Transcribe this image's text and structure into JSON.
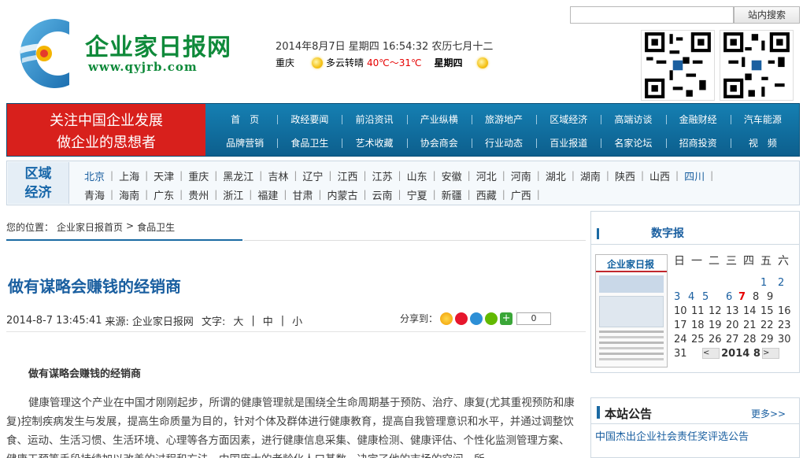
{
  "header": {
    "search_button": "站内搜索",
    "logo_cn": "企业家日报网",
    "logo_url": "www.qyjrb.com",
    "datetime": "2014年8月7日  星期四  16:54:32 农历七月十二",
    "weather": {
      "city": "重庆",
      "condition": "多云转晴",
      "temp": "40℃～31℃",
      "weekday": "星期四"
    }
  },
  "nav": {
    "slogan_line1": "关注中国企业发展",
    "slogan_line2": "做企业的思想者",
    "row1": [
      "首　页",
      "政经要闻",
      "前沿资讯",
      "产业纵横",
      "旅游地产",
      "区域经济",
      "高端访谈",
      "金融财经",
      "汽车能源"
    ],
    "row2": [
      "品牌营销",
      "食品卫生",
      "艺术收藏",
      "协会商会",
      "行业动态",
      "百业报道",
      "名家论坛",
      "招商投资",
      "视　频"
    ]
  },
  "region": {
    "label_line1": "区域",
    "label_line2": "经济",
    "row1": [
      "北京",
      "上海",
      "天津",
      "重庆",
      "黑龙江",
      "吉林",
      "辽宁",
      "江西",
      "江苏",
      "山东",
      "安徽",
      "河北",
      "河南",
      "湖北",
      "湖南",
      "陕西",
      "山西",
      "四川"
    ],
    "row2": [
      "青海",
      "海南",
      "广东",
      "贵州",
      "浙江",
      "福建",
      "甘肃",
      "内蒙古",
      "云南",
      "宁夏",
      "新疆",
      "西藏",
      "广西"
    ]
  },
  "breadcrumb": {
    "prefix": "您的位置：",
    "home": "企业家日报首页",
    "sep": ">",
    "current": "食品卫生"
  },
  "article": {
    "title": "做有谋略会赚钱的经销商",
    "date": "2014-8-7 13:45:41",
    "source_label": "来源:",
    "source": "企业家日报网",
    "font_label": "文字:",
    "font_sizes": [
      "大",
      "中",
      "小"
    ],
    "share_label": "分享到：",
    "share_count": "0",
    "subtitle": "做有谋略会赚钱的经销商",
    "body": "健康管理这个产业在中国才刚刚起步，所谓的健康管理就是围绕全生命周期基于预防、治疗、康复(尤其重视预防和康复)控制疾病发生与发展，提高生命质量为目的，针对个体及群体进行健康教育，提高自我管理意识和水平，并通过调整饮食、运动、生活习惯、生活环境、心理等各方面因素，进行健康信息采集、健康检测、健康评估、个性化监测管理方案、健康干预等手段持续加以改善的过程和方法。中国庞大的老龄化人口基数，决定了他的市场的空间，所"
  },
  "sidebar": {
    "digital_title": "数字报",
    "paper_title": "企业家日报",
    "calendar": {
      "weekdays": [
        "日",
        "一",
        "二",
        "三",
        "四",
        "五",
        "六"
      ],
      "weeks": [
        [
          "",
          "",
          "",
          "",
          "",
          "1",
          "2"
        ],
        [
          "3",
          "4",
          "5",
          "",
          "6",
          "7",
          "8",
          "9"
        ],
        [
          "10",
          "11",
          "12",
          "13",
          "14",
          "15",
          "16"
        ],
        [
          "17",
          "18",
          "19",
          "20",
          "21",
          "22",
          "23"
        ],
        [
          "24",
          "25",
          "26",
          "27",
          "28",
          "29",
          "30"
        ]
      ],
      "last_day": "31",
      "prev": "<",
      "next": ">",
      "year_month": "2014 8"
    },
    "notice_title": "本站公告",
    "notice_more": "更多>>",
    "notice_item": "中国杰出企业社会责任奖评选公告"
  },
  "colors": {
    "brand_green": "#0f8a3a",
    "nav_blue": "#157fb2",
    "slogan_red": "#d8201c",
    "link_blue": "#1a5fa0"
  }
}
